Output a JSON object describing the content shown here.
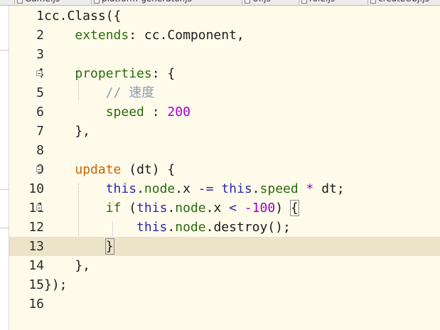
{
  "editor_tabs": [
    {
      "label": "Game.js"
    },
    {
      "label": "platform-generator.js"
    },
    {
      "label": "UI.js"
    },
    {
      "label": "role.js"
    },
    {
      "label": "createObj.js"
    }
  ],
  "colors": {
    "background": "#fffbeb",
    "current_line": "#ede3c9",
    "keyword": "#c86400",
    "property": "#2a6b0c",
    "this_keyword": "#2a2aa8",
    "number": "#a000c8",
    "comment": "#8a9bb0",
    "default": "#1a1a1a"
  },
  "lines": [
    {
      "number": "1",
      "fold": false,
      "tokens": [
        {
          "t": "cc.Class({",
          "c": "default"
        }
      ]
    },
    {
      "number": "2",
      "fold": false,
      "tokens": [
        {
          "t": "    ",
          "c": "default"
        },
        {
          "t": "extends",
          "c": "prop"
        },
        {
          "t": ": cc.Component,",
          "c": "default"
        }
      ]
    },
    {
      "number": "3",
      "fold": false,
      "tokens": []
    },
    {
      "number": "4",
      "fold": true,
      "tokens": [
        {
          "t": "    ",
          "c": "default"
        },
        {
          "t": "properties",
          "c": "prop"
        },
        {
          "t": ": {",
          "c": "default"
        }
      ]
    },
    {
      "number": "5",
      "fold": false,
      "tokens": [
        {
          "t": "        ",
          "c": "default"
        },
        {
          "t": "// 速度",
          "c": "comment"
        }
      ]
    },
    {
      "number": "6",
      "fold": false,
      "tokens": [
        {
          "t": "        ",
          "c": "default"
        },
        {
          "t": "speed",
          "c": "prop"
        },
        {
          "t": " : ",
          "c": "default"
        },
        {
          "t": "200",
          "c": "number"
        }
      ]
    },
    {
      "number": "7",
      "fold": false,
      "tokens": [
        {
          "t": "    },",
          "c": "default"
        }
      ]
    },
    {
      "number": "8",
      "fold": false,
      "tokens": []
    },
    {
      "number": "9",
      "fold": true,
      "tokens": [
        {
          "t": "    ",
          "c": "default"
        },
        {
          "t": "update",
          "c": "keyword"
        },
        {
          "t": " (dt) {",
          "c": "default"
        }
      ]
    },
    {
      "number": "10",
      "fold": false,
      "tokens": [
        {
          "t": "        ",
          "c": "default"
        },
        {
          "t": "this",
          "c": "this"
        },
        {
          "t": ".",
          "c": "default"
        },
        {
          "t": "node",
          "c": "prop"
        },
        {
          "t": ".x ",
          "c": "default"
        },
        {
          "t": "-=",
          "c": "this"
        },
        {
          "t": " ",
          "c": "default"
        },
        {
          "t": "this",
          "c": "this"
        },
        {
          "t": ".",
          "c": "default"
        },
        {
          "t": "speed",
          "c": "prop"
        },
        {
          "t": " ",
          "c": "default"
        },
        {
          "t": "*",
          "c": "operator"
        },
        {
          "t": " dt;",
          "c": "default"
        }
      ]
    },
    {
      "number": "11",
      "fold": true,
      "tokens": [
        {
          "t": "        ",
          "c": "default"
        },
        {
          "t": "if",
          "c": "prop"
        },
        {
          "t": " (",
          "c": "default"
        },
        {
          "t": "this",
          "c": "this"
        },
        {
          "t": ".",
          "c": "default"
        },
        {
          "t": "node",
          "c": "prop"
        },
        {
          "t": ".x ",
          "c": "default"
        },
        {
          "t": "<",
          "c": "this"
        },
        {
          "t": " ",
          "c": "default"
        },
        {
          "t": "-100",
          "c": "number"
        },
        {
          "t": ") ",
          "c": "default"
        },
        {
          "t": "{",
          "c": "bracket"
        }
      ]
    },
    {
      "number": "12",
      "fold": false,
      "tokens": [
        {
          "t": "            ",
          "c": "default"
        },
        {
          "t": "this",
          "c": "this"
        },
        {
          "t": ".",
          "c": "default"
        },
        {
          "t": "node",
          "c": "prop"
        },
        {
          "t": ".destroy();",
          "c": "default"
        }
      ]
    },
    {
      "number": "13",
      "fold": false,
      "current": true,
      "tokens": [
        {
          "t": "        ",
          "c": "default"
        },
        {
          "t": "}",
          "c": "bracket"
        }
      ]
    },
    {
      "number": "14",
      "fold": false,
      "tokens": [
        {
          "t": "    },",
          "c": "default"
        }
      ]
    },
    {
      "number": "15",
      "fold": false,
      "tokens": [
        {
          "t": "});",
          "c": "default"
        }
      ]
    },
    {
      "number": "16",
      "fold": false,
      "tokens": []
    }
  ]
}
